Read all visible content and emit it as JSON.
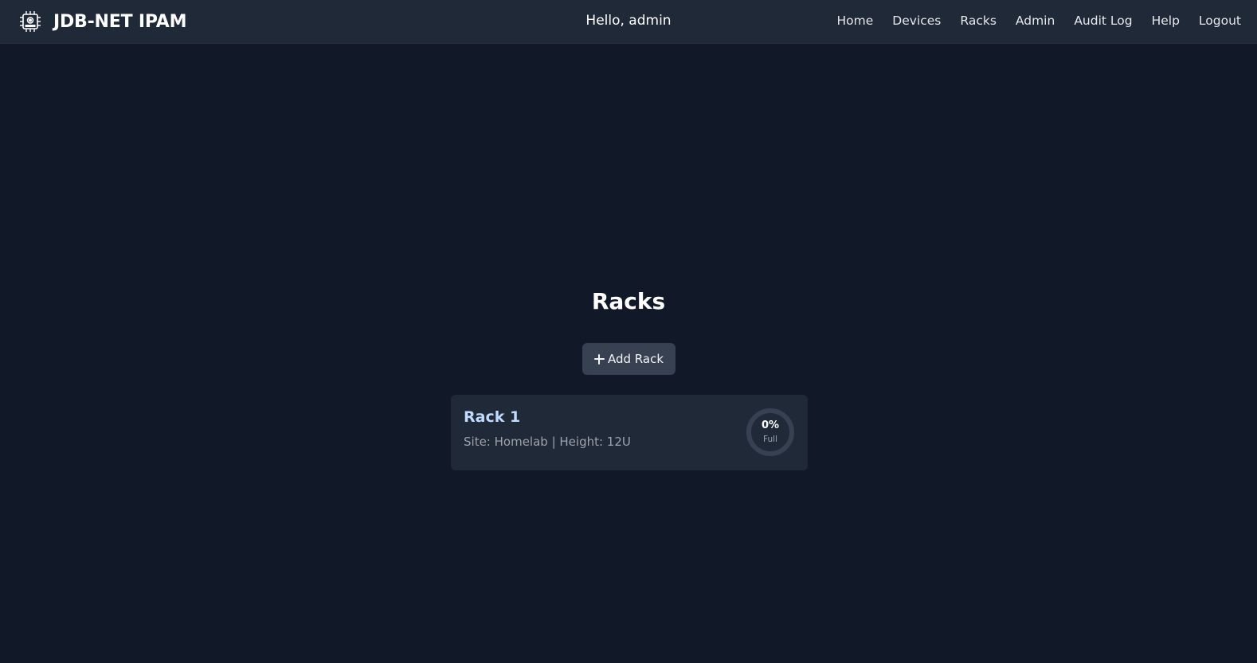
{
  "app": {
    "title": "JDB-NET IPAM",
    "logo_icon": "chip-network-icon"
  },
  "header": {
    "greeting": "Hello, admin",
    "nav": [
      {
        "label": "Home"
      },
      {
        "label": "Devices"
      },
      {
        "label": "Racks"
      },
      {
        "label": "Admin"
      },
      {
        "label": "Audit Log"
      },
      {
        "label": "Help"
      },
      {
        "label": "Logout"
      }
    ]
  },
  "main": {
    "title": "Racks",
    "add_button": {
      "label": "Add Rack",
      "icon": "plus-icon"
    },
    "racks": [
      {
        "name": "Rack 1",
        "meta": "Site: Homelab | Height: 12U",
        "utilization_percent": 0,
        "utilization_text": "0%",
        "utilization_label": "Full"
      }
    ]
  },
  "colors": {
    "background": "#111827",
    "navbar": "#1f2937",
    "card": "#1f2937",
    "button": "#374151",
    "rack_name": "#bfdbfe",
    "muted_text": "#9ca3af",
    "gauge_track": "#374151",
    "gauge_fill": "#3b82f6"
  }
}
